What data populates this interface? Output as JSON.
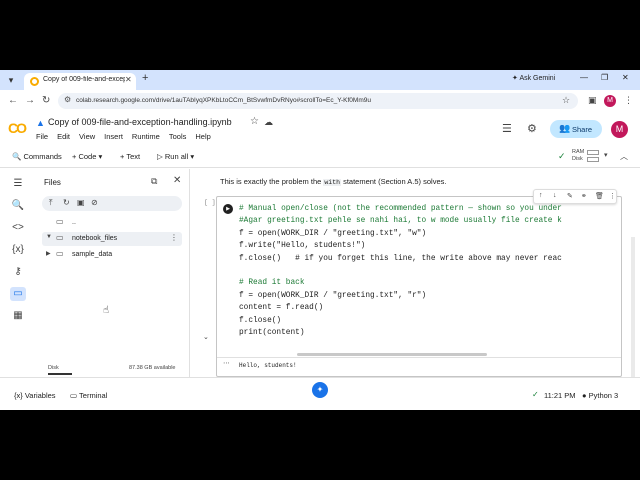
{
  "browser": {
    "tab_title": "Copy of 009-file-and-exception-",
    "tab_close": "✕",
    "new_tab": "+",
    "ask_gemini": "Ask Gemini",
    "url": "colab.research.google.com/drive/1auTAbIyqXPKbLtoCCm_BtSvwfmDvRNyo#scrollTo=Ec_Y-Kf0Mm9u",
    "profile_initial": "M"
  },
  "colab": {
    "notebook_title": "Copy of 009-file-and-exception-handling.ipynb",
    "menu": [
      "File",
      "Edit",
      "View",
      "Insert",
      "Runtime",
      "Tools",
      "Help"
    ],
    "share_label": "Share",
    "avatar_initial": "M"
  },
  "toolbar": {
    "commands": "Commands",
    "code": "+ Code",
    "text": "+ Text",
    "run_all": "Run all",
    "ram_label": "RAM",
    "disk_label": "Disk"
  },
  "files_panel": {
    "title": "Files",
    "items": [
      {
        "label": ".."
      },
      {
        "label": "notebook_files"
      },
      {
        "label": "sample_data"
      }
    ],
    "disk_label": "Disk",
    "disk_available": "87.38 GB available"
  },
  "notebook": {
    "text_before": "This is exactly the problem the ",
    "text_code": "with",
    "text_after": " statement (Section A.5) solves.",
    "cell_bracket": "[ ]",
    "code_lines": [
      "# Manual open/close (not the recommended pattern — shown so you under",
      "#Agar greeting.txt pehle se nahi hai, to w mode usually file create k",
      "f = open(WORK_DIR / \"greeting.txt\", \"w\")",
      "f.write(\"Hello, students!\")",
      "f.close()   # if you forget this line, the write above may never reac",
      "",
      "# Read it back",
      "f = open(WORK_DIR / \"greeting.txt\", \"r\")",
      "content = f.read()",
      "f.close()",
      "print(content)"
    ],
    "output": "Hello, students!"
  },
  "statusbar": {
    "variables": "Variables",
    "terminal": "Terminal",
    "time": "11:21 PM",
    "runtime": "Python 3"
  }
}
